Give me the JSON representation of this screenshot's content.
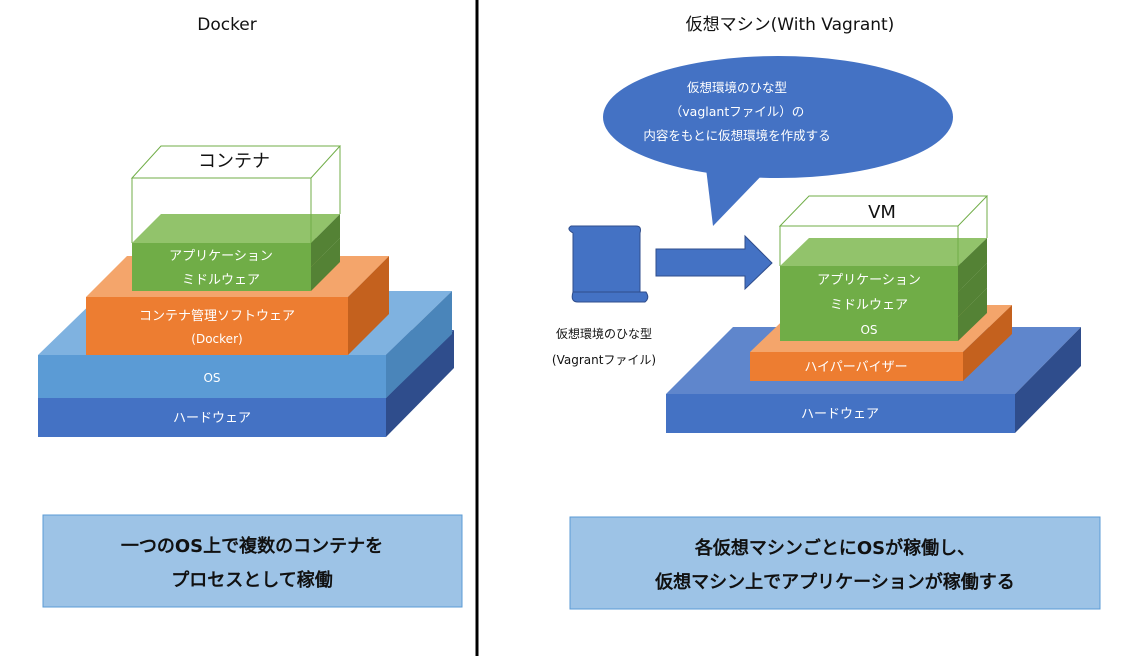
{
  "left": {
    "title": "Docker",
    "container_label": "コンテナ",
    "app_label": "アプリケーション",
    "middleware_label": "ミドルウェア",
    "container_mgmt_label": "コンテナ管理ソフトウェア",
    "container_mgmt_sub": "(Docker)",
    "os_label": "OS",
    "hardware_label": "ハードウェア",
    "summary_line1": "一つのOS上で複数のコンテナを",
    "summary_line2": "プロセスとして稼働"
  },
  "right": {
    "title": "仮想マシン(With Vagrant)",
    "bubble_line1": "仮想環境のひな型",
    "bubble_line2": "（vaglantファイル）の",
    "bubble_line3": "内容をもとに仮想環境を作成する",
    "scroll_caption1": "仮想環境のひな型",
    "scroll_caption2": "(Vagrantファイル)",
    "vm_label": "VM",
    "app_label": "アプリケーション",
    "middleware_label": "ミドルウェア",
    "os_label": "OS",
    "hypervisor_label": "ハイパーバイザー",
    "hardware_label": "ハードウェア",
    "summary_line1": "各仮想マシンごとにOSが稼働し、",
    "summary_line2": "仮想マシン上でアプリケーションが稼働する"
  },
  "colors": {
    "hardware": "#4472c4",
    "os": "#5b9bd5",
    "orange": "#ed7d31",
    "green": "#70ad47",
    "summary_bg": "#9dc3e6"
  }
}
